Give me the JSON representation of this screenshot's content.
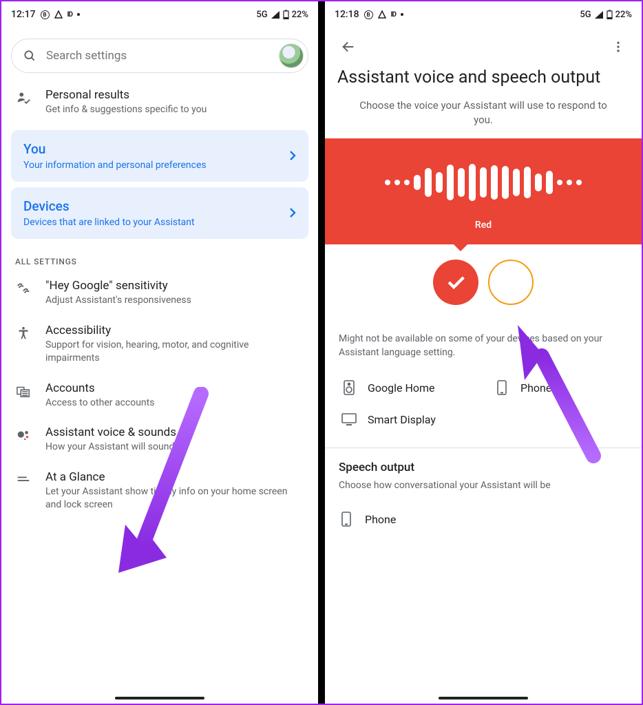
{
  "left": {
    "status": {
      "time": "12:17",
      "net": "5G",
      "batt": "22%"
    },
    "search": {
      "placeholder": "Search settings"
    },
    "personal": {
      "title": "Personal results",
      "sub": "Get info & suggestions specific to you"
    },
    "card_you": {
      "title": "You",
      "sub": "Your information and personal preferences"
    },
    "card_devices": {
      "title": "Devices",
      "sub": "Devices that are linked to your Assistant"
    },
    "all_header": "ALL SETTINGS",
    "items": {
      "hey": {
        "title": "\"Hey Google\" sensitivity",
        "sub": "Adjust Assistant's responsiveness"
      },
      "acc": {
        "title": "Accessibility",
        "sub": "Support for vision, hearing, motor, and cognitive impairments"
      },
      "acct": {
        "title": "Accounts",
        "sub": "Access to other accounts"
      },
      "voice": {
        "title": "Assistant voice & sounds",
        "sub": "How your Assistant will sound"
      },
      "glance": {
        "title": "At a Glance",
        "sub": "Let your Assistant show timely info on your home screen and lock screen"
      }
    }
  },
  "right": {
    "status": {
      "time": "12:18",
      "net": "5G",
      "batt": "22%"
    },
    "title": "Assistant voice and speech output",
    "sub": "Choose the voice your Assistant will use to respond to you.",
    "voice_name": "Red",
    "note": "Might not be available on some of your devices based on your Assistant language setting.",
    "devices": {
      "a": "Google Home",
      "b": "Phone",
      "c": "Smart Display"
    },
    "speech": {
      "title": "Speech output",
      "sub": "Choose how conversational your Assistant will be",
      "opt": "Phone"
    }
  }
}
